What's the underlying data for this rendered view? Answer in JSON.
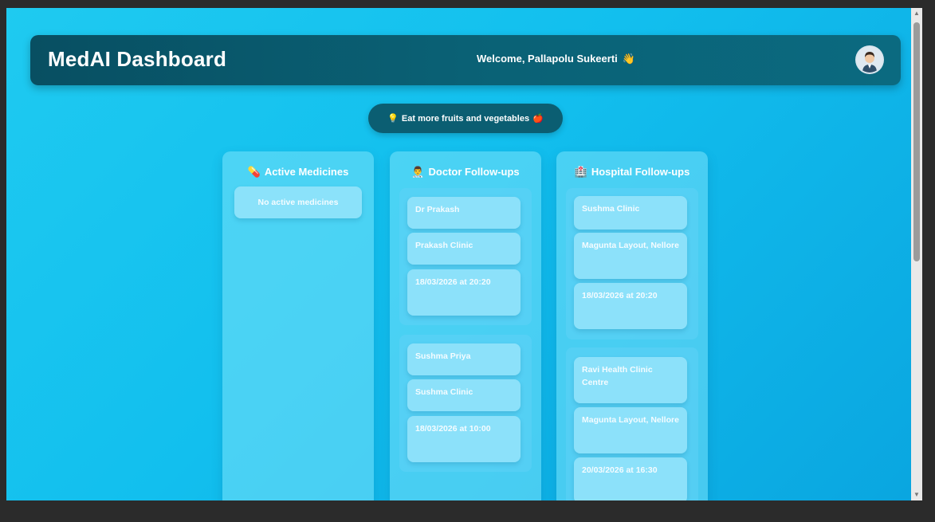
{
  "header": {
    "title": "MedAI Dashboard",
    "welcome": "Welcome, Pallapolu Sukeerti",
    "wave_emoji": "👋"
  },
  "tip": {
    "bulb": "💡",
    "text": "Eat more fruits and vegetables",
    "apple": "🍎"
  },
  "columns": {
    "medicines": {
      "icon": "💊",
      "title": "Active Medicines",
      "empty": "No active medicines"
    },
    "doctor": {
      "icon": "👨‍⚕️",
      "title": "Doctor Follow-ups",
      "items": [
        {
          "name": "Dr Prakash",
          "clinic": "Prakash Clinic",
          "when": "18/03/2026 at 20:20"
        },
        {
          "name": "Sushma Priya",
          "clinic": "Sushma Clinic",
          "when": "18/03/2026 at 10:00"
        }
      ]
    },
    "hospital": {
      "icon": "🏥",
      "title": "Hospital Follow-ups",
      "items": [
        {
          "name": "Sushma Clinic",
          "address": "Magunta Layout, Nellore",
          "when": "18/03/2026 at 20:20"
        },
        {
          "name": "Ravi Health Clinic Centre",
          "address": "Magunta Layout, Nellore",
          "when": "20/03/2026 at 16:30"
        }
      ]
    }
  }
}
